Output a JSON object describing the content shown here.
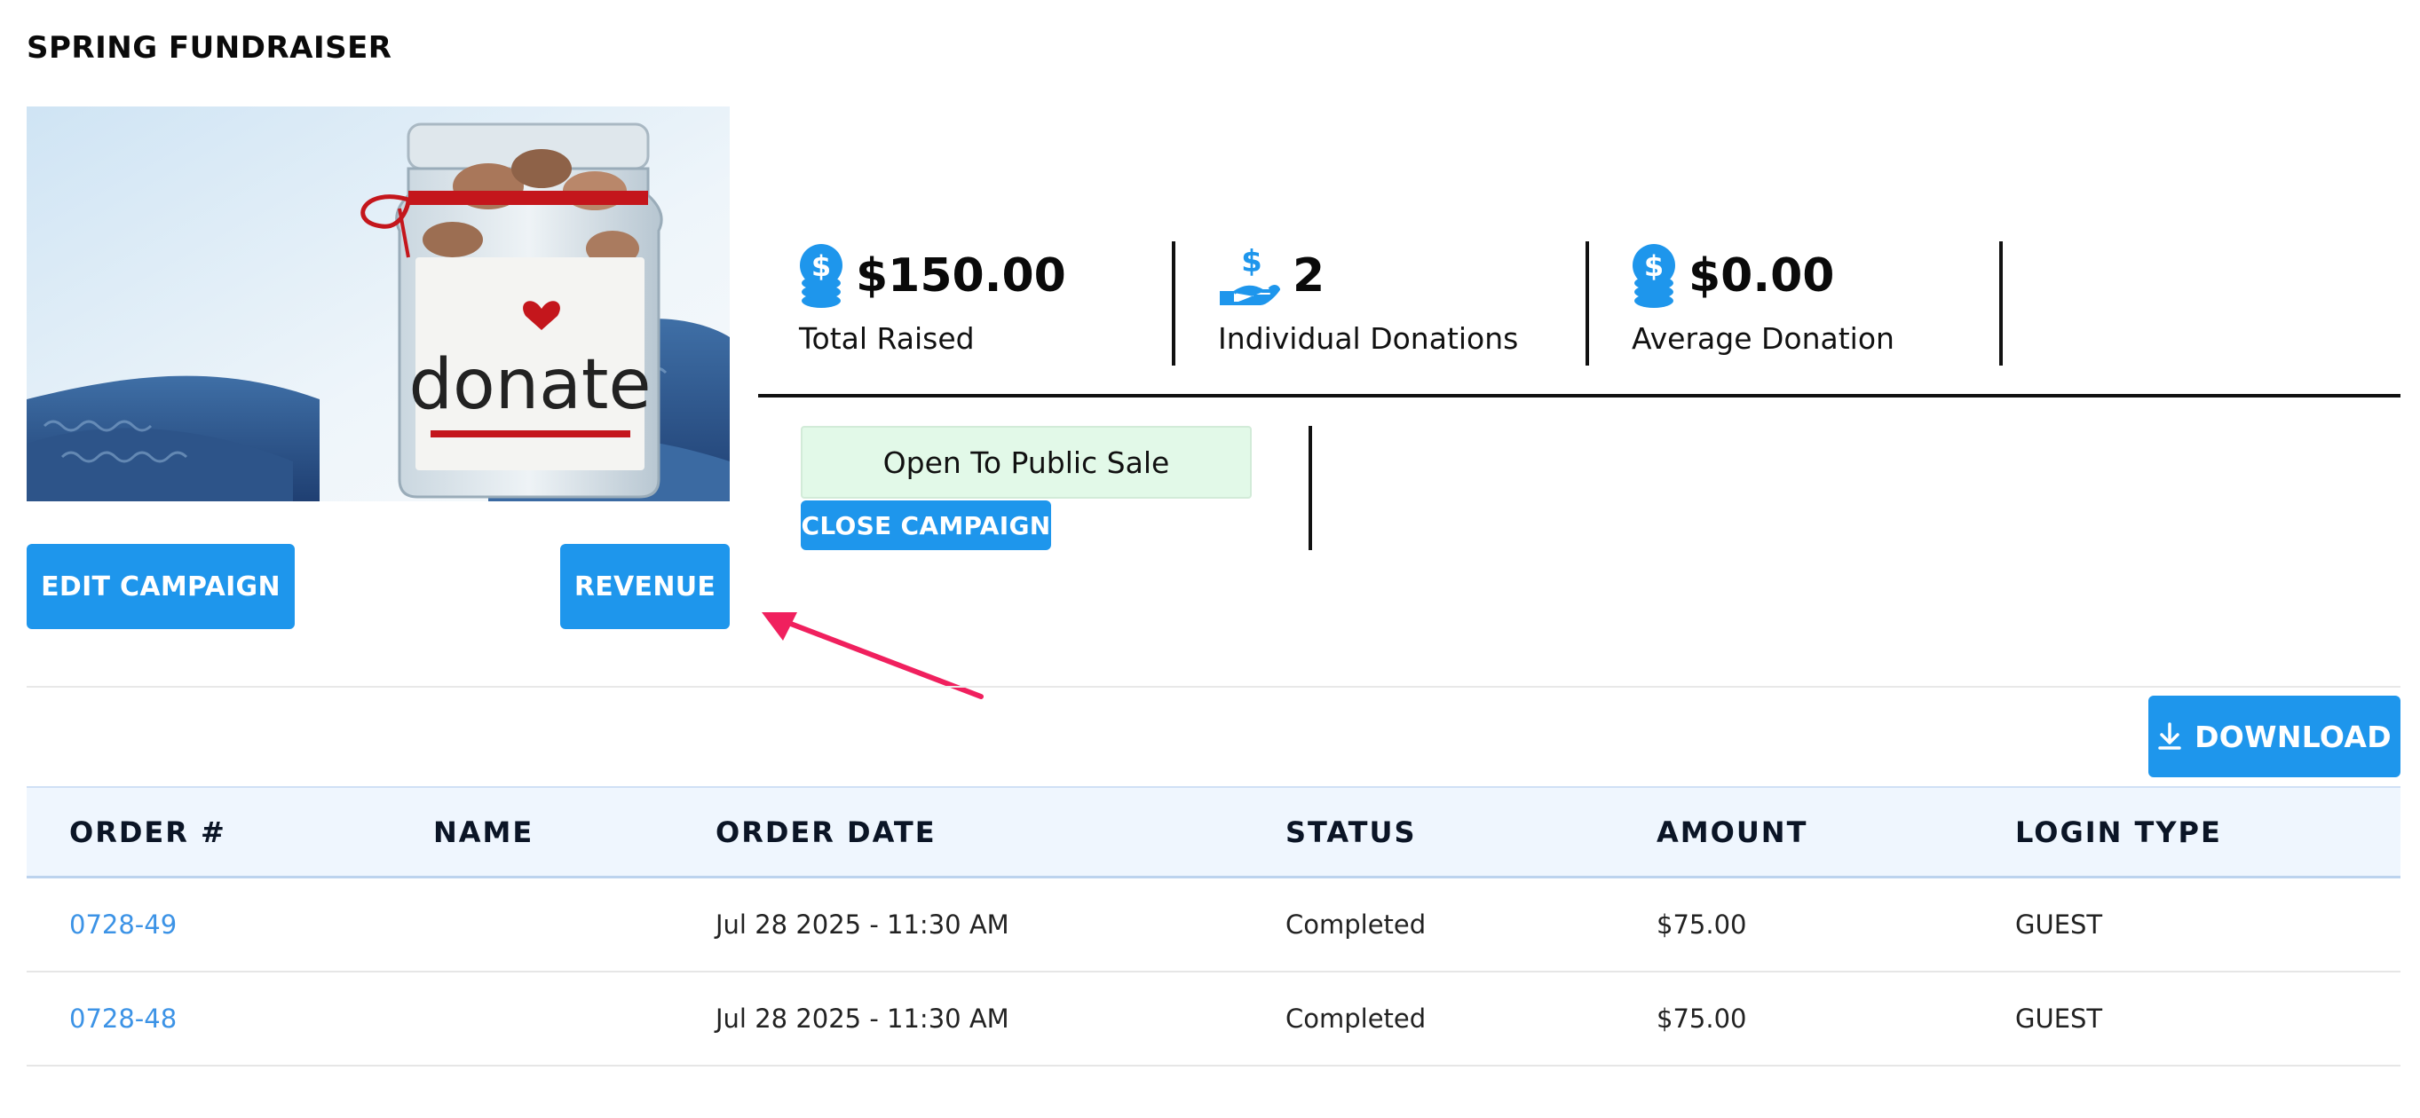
{
  "page": {
    "title": "SPRING FUNDRAISER"
  },
  "hero": {
    "jar_label": "donate"
  },
  "actions": {
    "edit_label": "EDIT CAMPAIGN",
    "revenue_label": "REVENUE"
  },
  "stats": [
    {
      "icon": "coin-stack-icon",
      "value": "$150.00",
      "label": "Total Raised"
    },
    {
      "icon": "hand-dollar-icon",
      "value": "2",
      "label": "Individual Donations"
    },
    {
      "icon": "coin-stack-icon",
      "value": "$0.00",
      "label": "Average Donation"
    }
  ],
  "campaign": {
    "status": "Open To Public Sale",
    "close_label": "CLOSE CAMPAIGN"
  },
  "download": {
    "label": "DOWNLOAD",
    "icon": "download-icon"
  },
  "table": {
    "headers": [
      "ORDER #",
      "NAME",
      "ORDER DATE",
      "STATUS",
      "AMOUNT",
      "LOGIN TYPE"
    ],
    "rows": [
      {
        "order": "0728-49",
        "name": "",
        "date": "Jul 28 2025 - 11:30 AM",
        "status": "Completed",
        "amount": "$75.00",
        "login": "GUEST"
      },
      {
        "order": "0728-48",
        "name": "",
        "date": "Jul 28 2025 - 11:30 AM",
        "status": "Completed",
        "amount": "$75.00",
        "login": "GUEST"
      }
    ]
  },
  "colors": {
    "accent": "#1e96ec",
    "arrow": "#f0205e",
    "status_bg": "#e2f9e8",
    "link": "#3c93e6"
  }
}
